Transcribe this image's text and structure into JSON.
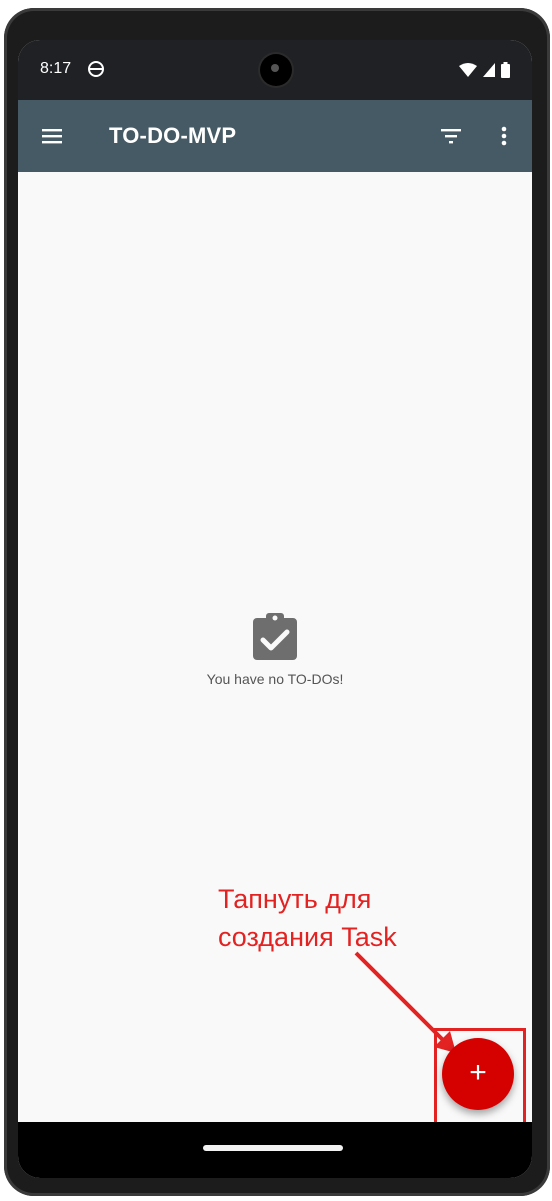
{
  "status_bar": {
    "time": "8:17",
    "icons": [
      "sync-icon",
      "wifi-icon",
      "signal-icon",
      "battery-icon"
    ]
  },
  "app_bar": {
    "title": "TO-DO-MVP",
    "background_color": "#455a64",
    "icons": [
      "menu-icon",
      "filter-icon",
      "more-vert-icon"
    ]
  },
  "empty_state": {
    "icon": "clipboard-check-icon",
    "message": "You have no TO-DOs!"
  },
  "annotation": {
    "text": "Тапнуть для\nсоздания Task",
    "color": "#e32222"
  },
  "fab": {
    "label": "+",
    "icon": "add-icon",
    "color": "#d50000"
  }
}
